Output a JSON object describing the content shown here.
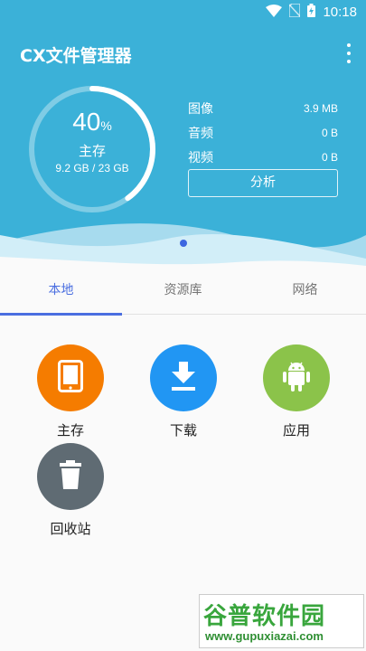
{
  "status": {
    "time": "10:18"
  },
  "app": {
    "title": "CX文件管理器"
  },
  "storage": {
    "percent": "40",
    "percent_sign": "%",
    "name": "主存",
    "size": "9.2 GB / 23 GB",
    "used_fraction": 0.4
  },
  "stats": [
    {
      "label": "图像",
      "value": "3.9 MB"
    },
    {
      "label": "音频",
      "value": "0 B"
    },
    {
      "label": "视频",
      "value": "0 B"
    }
  ],
  "analyze_label": "分析",
  "tabs": [
    {
      "label": "本地",
      "active": true
    },
    {
      "label": "资源库",
      "active": false
    },
    {
      "label": "网络",
      "active": false
    }
  ],
  "items": [
    {
      "label": "主存",
      "icon": "tablet-icon",
      "color": "#f57c00"
    },
    {
      "label": "下载",
      "icon": "download-icon",
      "color": "#2196f3"
    },
    {
      "label": "应用",
      "icon": "android-icon",
      "color": "#8bc34a"
    },
    {
      "label": "回收站",
      "icon": "trash-icon",
      "color": "#5f6b73"
    }
  ],
  "watermark": {
    "main": "谷普软件园",
    "url": "www.gupuxiazai.com"
  }
}
